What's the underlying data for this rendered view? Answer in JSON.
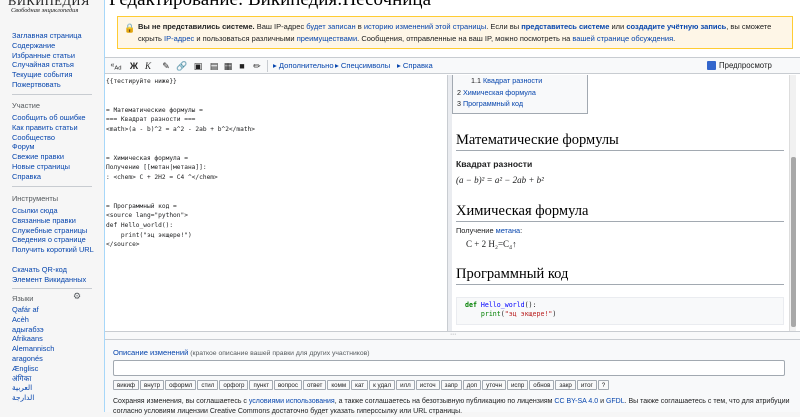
{
  "logo": {
    "title": "ВИКИПЕДИЯ",
    "subtitle": "Свободная энциклопедия"
  },
  "page_title": "Редактирование: Википедия:Песочница",
  "sidebar": {
    "main_items": [
      "Заглавная страница",
      "Содержание",
      "Избранные статьи",
      "Случайная статья",
      "Текущие события",
      "Пожертвовать"
    ],
    "participation_head": "Участие",
    "participation_items": [
      "Сообщить об ошибке",
      "Как править статьи",
      "Сообщество",
      "Форум",
      "Свежие правки",
      "Новые страницы",
      "Справка"
    ],
    "tools_head": "Инструменты",
    "tools_items": [
      "Ссылки сюда",
      "Связанные правки",
      "Служебные страницы",
      "Сведения о странице",
      "Получить короткий URL",
      "Скачать QR-код",
      "Элемент Викиданных"
    ],
    "languages_head": "Языки",
    "language_items": [
      "Qafár af",
      "Acèh",
      "адыгабзэ",
      "Afrikaans",
      "Alemannisch",
      "aragonés",
      "Ænglisc",
      "अंगिका",
      "العربية",
      "الدارجة"
    ]
  },
  "warning": {
    "bold": "Вы не представились системе.",
    "t1": " Ваш IP-адрес ",
    "l1": "будет записан",
    "t2": " в ",
    "l2": "историю изменений этой страницы",
    "t3": ". Если вы ",
    "l3": "представитесь системе",
    "t4": " или ",
    "l4": "создадите учётную запись",
    "t5": ", вы сможете скрыть ",
    "l5": "IP-адрес",
    "t6": " и пользоваться различными ",
    "l6": "преимуществами",
    "t7": ". Сообщения, отправленные на ваш IP, можно посмотреть на ",
    "l7": "вашей странице обсуждения",
    "t8": "."
  },
  "toolbar": {
    "advanced": "Дополнительно",
    "special_chars": "Спецсимволы",
    "help": "Справка",
    "preview": "Предпросмотр"
  },
  "editor_text": "{{тестируйте ниже}}\n\n\n= Математические формулы =\n=== Квадрат разности ===\n<math>(a - b)^2 = a^2 - 2ab + b^2</math>\n\n\n= Химическая формула =\nПолучение [[метан|метана]]:\n: <chem> C + 2H2 = C4 ^</chem>\n\n\n= Программный код =\n<source lang=\"python\">\ndef Hello_world():\n    print(\"эц экщере!\")\n</source>",
  "preview": {
    "toc": [
      {
        "num": "1.1",
        "label": "Квадрат разности"
      },
      {
        "num": "2",
        "label": "Химическая формула"
      },
      {
        "num": "3",
        "label": "Программный код"
      }
    ],
    "h_math": "Математические формулы",
    "h_square": "Квадрат разности",
    "formula": "(a − b)² = a² − 2ab + b²",
    "h_chem": "Химическая формула",
    "chem_text": "Получение ",
    "chem_link": "метана",
    "chem_colon": ":",
    "chem_formula": "C + 2 H₂=C₄↑",
    "h_code": "Программный код",
    "code_kw": "def",
    "code_fn": "Hello_world",
    "code_rest": "():",
    "code_print": "print",
    "code_str": "\"эц экщере!\"",
    "code_close": ")"
  },
  "summary": {
    "label": "Описание изменений",
    "hint": " (краткое описание вашей правки для других участников)",
    "value": ""
  },
  "chips": [
    "викиф",
    "внутр",
    "оформл",
    "стил",
    "орфогр",
    "пункт",
    "вопрос",
    "ответ",
    "комм",
    "кат",
    "к удал",
    "илл",
    "источ",
    "запр",
    "доп",
    "уточн",
    "испр",
    "обнов",
    "закр",
    "итог",
    "?"
  ],
  "license": {
    "t1": "Сохраняя изменения, вы соглашаетесь с ",
    "l1": "условиями использования",
    "t2": ", а также соглашаетесь на безотзывную публикацию по лицензиям ",
    "l2": "CC BY-SA 4.0",
    "t3": " и ",
    "l3": "GFDL",
    "t4": ". Вы также соглашаетесь с тем, что для атрибуции согласно условиям лицензии Creative Commons достаточно будет указать гиперссылку или URL страницы."
  },
  "colors": {
    "link": "#0645ad",
    "warning_bg": "#fef6e7",
    "warning_border": "#ffcc33",
    "preview_accent": "#3366cc"
  }
}
